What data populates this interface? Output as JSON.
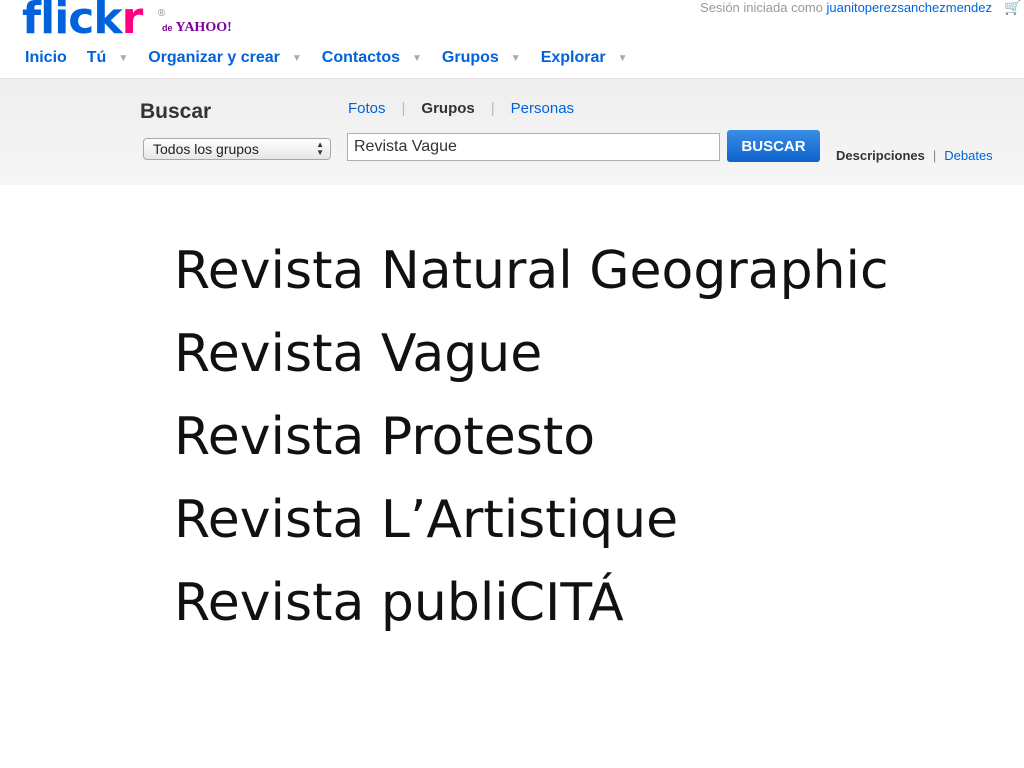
{
  "logo": {
    "text_main": "flick",
    "text_accent": "r",
    "registered": "®",
    "sub_de": "de",
    "sub_brand": "YAHOO!"
  },
  "account": {
    "signed_in_prefix": "Sesión iniciada como ",
    "username": "juanitoperezsanchezmendez"
  },
  "nav": {
    "items": [
      {
        "label": "Inicio",
        "has_caret": false
      },
      {
        "label": "Tú",
        "has_caret": true
      },
      {
        "label": "Organizar y crear",
        "has_caret": true
      },
      {
        "label": "Contactos",
        "has_caret": true
      },
      {
        "label": "Grupos",
        "has_caret": true
      },
      {
        "label": "Explorar",
        "has_caret": true
      }
    ]
  },
  "search": {
    "title": "Buscar",
    "tabs": [
      {
        "label": "Fotos",
        "active": false
      },
      {
        "label": "Grupos",
        "active": true
      },
      {
        "label": "Personas",
        "active": false
      }
    ],
    "scope_selected": "Todos los grupos",
    "query": "Revista Vague",
    "button_label": "BUSCAR",
    "option_descripciones": "Descripciones",
    "option_separator": "|",
    "option_debates": "Debates"
  },
  "revistas": [
    "Revista Natural Geographic",
    "Revista Vague",
    "Revista Protesto",
    "Revista L’Artistique",
    "Revista publiCITÁ"
  ],
  "colors": {
    "brand_blue": "#0063dc",
    "brand_pink": "#ff0084",
    "yahoo_purple": "#7b0099",
    "button_blue": "#0d63cc"
  },
  "icons": [
    "cart-icon",
    "caret-down-icon",
    "select-arrows-icon"
  ]
}
